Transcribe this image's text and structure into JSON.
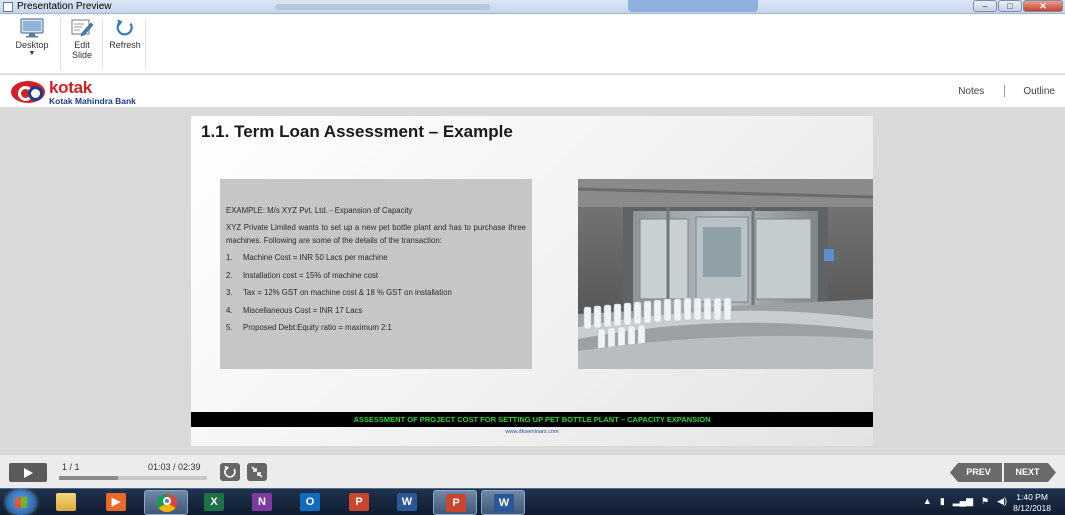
{
  "window": {
    "title": "Presentation Preview",
    "controls": {
      "minimize": "–",
      "maximize": "□",
      "close": "✕"
    }
  },
  "toolbar": {
    "desktop_label": "Desktop",
    "edit_label_line1": "Edit",
    "edit_label_line2": "Slide",
    "refresh_label": "Refresh"
  },
  "header": {
    "logo_word": "kotak",
    "logo_sub": "Kotak Mahindra Bank",
    "notes_label": "Notes",
    "outline_label": "Outline"
  },
  "slide": {
    "title": "1.1. Term Loan Assessment – Example",
    "example_heading": "EXAMPLE: M/s XYZ Pvt. Ltd. - Expansion of Capacity",
    "intro": "XYZ Private Limited wants to set up a new pet bottle plant and has to purchase three machines. Following are some of the details of the transaction:",
    "items": [
      {
        "num": "1.",
        "text": "Machine Cost = INR 50 Lacs per machine"
      },
      {
        "num": "2.",
        "text": "Installation cost = 15% of machine cost"
      },
      {
        "num": "3.",
        "text": "Tax = 12% GST on machine cost & 18 % GST on installation"
      },
      {
        "num": "4.",
        "text": "Miscellaneous Cost = INR 17 Lacs"
      },
      {
        "num": "5.",
        "text": "Proposed Debt:Equity ratio = maximum 2:1"
      }
    ],
    "banner": "ASSESSMENT OF PROJECT COST FOR SETTING UP PET BOTTLE PLANT – CAPACITY EXPANSION",
    "footer_link": "www.dkseminars.com",
    "colors": {
      "banner_bg": "#000000",
      "banner_text": "#2ed52e",
      "textbox_bg": "#c6c6c6"
    }
  },
  "player": {
    "slide_counter": "1 / 1",
    "time": "01:03 / 02:39",
    "progress_fraction": 0.4,
    "prev_label": "PREV",
    "next_label": "NEXT"
  },
  "taskbar": {
    "apps": [
      {
        "name": "file-explorer",
        "glyph": "",
        "active": false
      },
      {
        "name": "media-player",
        "glyph": "▶",
        "active": false
      },
      {
        "name": "chrome",
        "glyph": "",
        "active": true
      },
      {
        "name": "excel",
        "glyph": "X",
        "active": false
      },
      {
        "name": "onenote",
        "glyph": "N",
        "active": false
      },
      {
        "name": "outlook",
        "glyph": "O",
        "active": false
      },
      {
        "name": "powerpoint",
        "glyph": "P",
        "active": false
      },
      {
        "name": "word",
        "glyph": "W",
        "active": false
      },
      {
        "name": "powerpoint-active",
        "glyph": "P",
        "active": true
      },
      {
        "name": "word-2",
        "glyph": "W",
        "active": true
      }
    ],
    "clock_time": "1:40 PM",
    "clock_date": "8/12/2018"
  }
}
